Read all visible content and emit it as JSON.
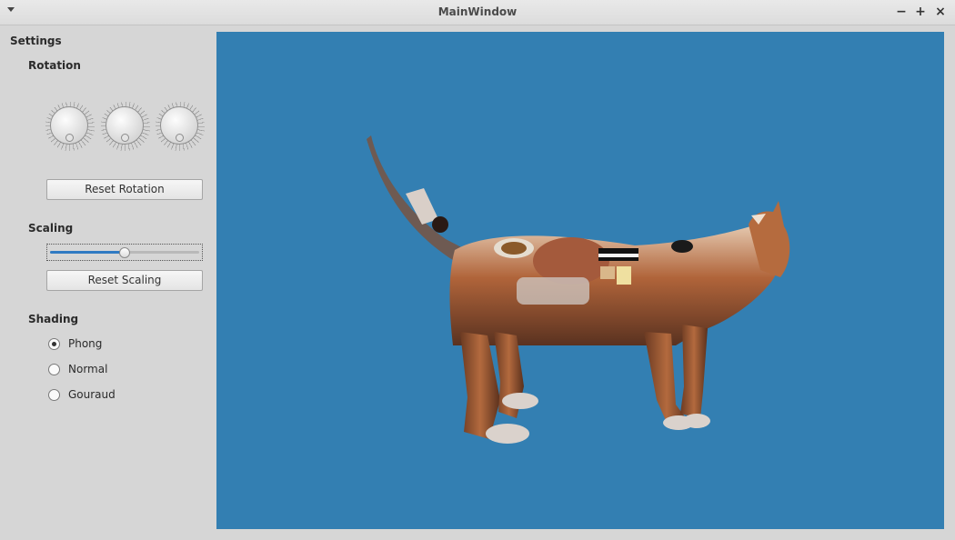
{
  "window": {
    "title": "MainWindow"
  },
  "settings": {
    "title": "Settings",
    "rotation": {
      "title": "Rotation",
      "reset_label": "Reset Rotation"
    },
    "scaling": {
      "title": "Scaling",
      "reset_label": "Reset Scaling",
      "slider_value": 0.5
    },
    "shading": {
      "title": "Shading",
      "options": [
        {
          "label": "Phong",
          "checked": true
        },
        {
          "label": "Normal",
          "checked": false
        },
        {
          "label": "Gouraud",
          "checked": false
        }
      ]
    }
  },
  "viewport": {
    "background": "#337fb2"
  }
}
